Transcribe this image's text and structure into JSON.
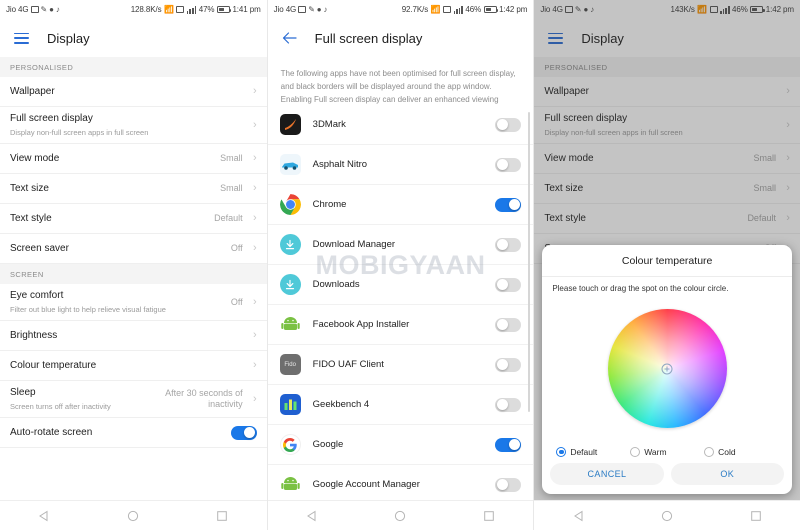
{
  "accent": "#1a78e8",
  "panel1": {
    "status": {
      "carrier": "Jio 4G",
      "speed": "128.8K/s",
      "battery": "47%",
      "time": "1:41 pm"
    },
    "appbar": {
      "title": "Display"
    },
    "sections": [
      {
        "header": "PERSONALISED",
        "rows": [
          {
            "title": "Wallpaper",
            "subtitle": "",
            "value": "",
            "chevron": "›"
          },
          {
            "title": "Full screen display",
            "subtitle": "Display non-full screen apps in full screen",
            "value": "",
            "chevron": "›"
          },
          {
            "title": "View mode",
            "subtitle": "",
            "value": "Small",
            "chevron": "›"
          },
          {
            "title": "Text size",
            "subtitle": "",
            "value": "Small",
            "chevron": "›"
          },
          {
            "title": "Text style",
            "subtitle": "",
            "value": "Default",
            "chevron": "›"
          },
          {
            "title": "Screen saver",
            "subtitle": "",
            "value": "Off",
            "chevron": "›"
          }
        ]
      },
      {
        "header": "SCREEN",
        "rows": [
          {
            "title": "Eye comfort",
            "subtitle": "Filter out blue light to help relieve visual fatigue",
            "value": "Off",
            "chevron": "›"
          },
          {
            "title": "Brightness",
            "subtitle": "",
            "value": "",
            "chevron": "›"
          },
          {
            "title": "Colour temperature",
            "subtitle": "",
            "value": "",
            "chevron": "›"
          },
          {
            "title": "Sleep",
            "subtitle": "Screen turns off after inactivity",
            "value": "After 30 seconds of inactivity",
            "chevron": "›"
          },
          {
            "title": "Auto-rotate screen",
            "subtitle": "",
            "value": "",
            "toggle": "on"
          }
        ]
      }
    ]
  },
  "panel2": {
    "status": {
      "carrier": "Jio 4G",
      "speed": "92.7K/s",
      "battery": "46%",
      "time": "1:42 pm"
    },
    "appbar": {
      "title": "Full screen display",
      "back_icon": "back-arrow-icon"
    },
    "description": "The following apps have not been optimised for full screen display, and black borders will be displayed around the app window. Enabling Full screen display can deliver an enhanced viewing experience, but may cause apps to display incorrectly. Apps currently running in the background will be re-launched.",
    "watermark": "MOBIGYAAN",
    "apps": [
      {
        "name": "3DMark",
        "icon": "3dmark-icon",
        "toggle": "off"
      },
      {
        "name": "Asphalt Nitro",
        "icon": "asphalt-nitro-icon",
        "toggle": "off"
      },
      {
        "name": "Chrome",
        "icon": "chrome-icon",
        "toggle": "on"
      },
      {
        "name": "Download Manager",
        "icon": "download-manager-icon",
        "toggle": "off"
      },
      {
        "name": "Downloads",
        "icon": "downloads-icon",
        "toggle": "off"
      },
      {
        "name": "Facebook App Installer",
        "icon": "android-icon",
        "toggle": "off"
      },
      {
        "name": "FIDO UAF Client",
        "icon": "fido-icon",
        "toggle": "off"
      },
      {
        "name": "Geekbench 4",
        "icon": "geekbench-icon",
        "toggle": "off"
      },
      {
        "name": "Google",
        "icon": "google-icon",
        "toggle": "on"
      },
      {
        "name": "Google Account Manager",
        "icon": "android-icon",
        "toggle": "off"
      }
    ]
  },
  "panel3": {
    "status": {
      "carrier": "Jio 4G",
      "speed": "143K/s",
      "battery": "46%",
      "time": "1:42 pm"
    },
    "appbar": {
      "title": "Display"
    },
    "sections": [
      {
        "header": "PERSONALISED",
        "rows": [
          {
            "title": "Wallpaper",
            "subtitle": "",
            "value": "",
            "chevron": "›"
          },
          {
            "title": "Full screen display",
            "subtitle": "Display non-full screen apps in full screen",
            "value": "",
            "chevron": "›"
          },
          {
            "title": "View mode",
            "subtitle": "",
            "value": "Small",
            "chevron": "›"
          },
          {
            "title": "Text size",
            "subtitle": "",
            "value": "Small",
            "chevron": "›"
          },
          {
            "title": "Text style",
            "subtitle": "",
            "value": "Default",
            "chevron": "›"
          },
          {
            "title": "Screen saver",
            "subtitle": "",
            "value": "Off",
            "chevron": "›"
          }
        ]
      }
    ],
    "dialog": {
      "title": "Colour temperature",
      "instruction": "Please touch or drag the spot on the colour circle.",
      "options": [
        {
          "label": "Default",
          "selected": true
        },
        {
          "label": "Warm",
          "selected": false
        },
        {
          "label": "Cold",
          "selected": false
        }
      ],
      "cancel_label": "CANCEL",
      "ok_label": "OK"
    }
  },
  "navbar": {
    "back": "back-triangle-icon",
    "home": "home-circle-icon",
    "recents": "recents-square-icon"
  }
}
